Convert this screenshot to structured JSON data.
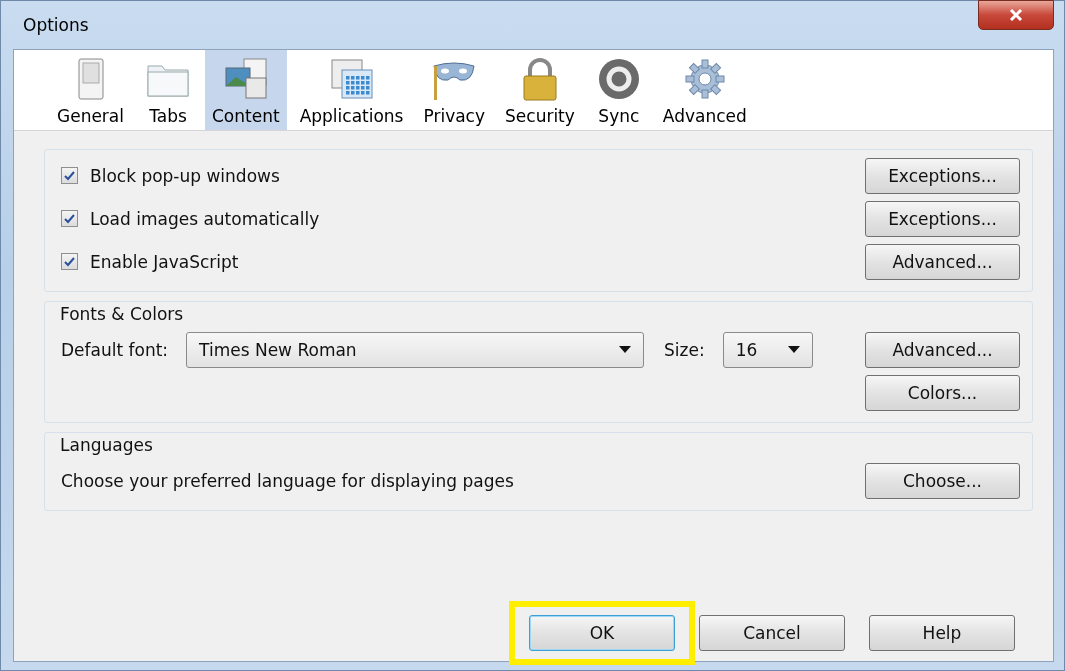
{
  "window": {
    "title": "Options"
  },
  "tabs": [
    {
      "label": "General",
      "kind": "switch",
      "selected": false
    },
    {
      "label": "Tabs",
      "kind": "folder",
      "selected": false
    },
    {
      "label": "Content",
      "kind": "pictures",
      "selected": true
    },
    {
      "label": "Applications",
      "kind": "grid",
      "selected": false
    },
    {
      "label": "Privacy",
      "kind": "mask",
      "selected": false
    },
    {
      "label": "Security",
      "kind": "padlock",
      "selected": false
    },
    {
      "label": "Sync",
      "kind": "cycle",
      "selected": false
    },
    {
      "label": "Advanced",
      "kind": "gear",
      "selected": false
    }
  ],
  "content_options": [
    {
      "label": "Block pop-up windows",
      "checked": true,
      "button": "Exceptions..."
    },
    {
      "label": "Load images automatically",
      "checked": true,
      "button": "Exceptions..."
    },
    {
      "label": "Enable JavaScript",
      "checked": true,
      "button": "Advanced..."
    }
  ],
  "fonts_colors": {
    "title": "Fonts & Colors",
    "default_font_label": "Default font:",
    "default_font": "Times New Roman",
    "size_label": "Size:",
    "size": "16",
    "buttons": [
      "Advanced...",
      "Colors..."
    ]
  },
  "languages": {
    "title": "Languages",
    "text": "Choose your preferred language for displaying pages",
    "button": "Choose..."
  },
  "buttons": [
    {
      "label": "OK",
      "highlighted": true
    },
    {
      "label": "Cancel",
      "highlighted": false
    },
    {
      "label": "Help",
      "highlighted": false
    }
  ]
}
